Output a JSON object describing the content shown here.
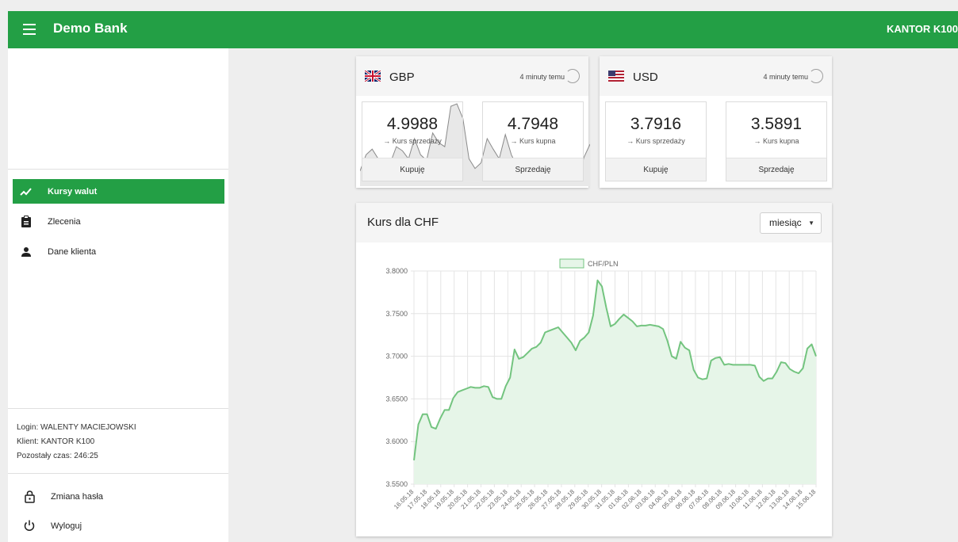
{
  "header": {
    "app_title": "Demo Bank",
    "account_label": "KANTOR K100"
  },
  "sidebar": {
    "nav": [
      {
        "label": "Kursy walut",
        "icon": "trending-up-icon",
        "active": true
      },
      {
        "label": "Zlecenia",
        "icon": "clipboard-icon",
        "active": false
      },
      {
        "label": "Dane klienta",
        "icon": "person-icon",
        "active": false
      }
    ],
    "session": {
      "login": "Login: WALENTY MACIEJOWSKI",
      "client": "Klient: KANTOR K100",
      "remaining": "Pozostały czas: 246:25"
    },
    "bottom": [
      {
        "label": "Zmiana hasła",
        "icon": "lock-icon"
      },
      {
        "label": "Wyloguj",
        "icon": "power-icon"
      }
    ]
  },
  "rates": [
    {
      "code": "GBP",
      "flag": "uk-flag-icon",
      "updated": "4 minuty temu",
      "sell": {
        "value": "4.9988",
        "label": "→ Kurs sprzedaży",
        "button": "Kupuję"
      },
      "buy": {
        "value": "4.7948",
        "label": "→ Kurs kupna",
        "button": "Sprzedaję"
      }
    },
    {
      "code": "USD",
      "flag": "us-flag-icon",
      "updated": "4 minuty temu",
      "sell": {
        "value": "3.7916",
        "label": "→ Kurs sprzedaży",
        "button": "Kupuję"
      },
      "buy": {
        "value": "3.5891",
        "label": "→ Kurs kupna",
        "button": "Sprzedaję"
      }
    }
  ],
  "chart_panel": {
    "title": "Kurs dla CHF",
    "period": "miesiąc"
  },
  "chart_data": {
    "type": "area",
    "legend": "CHF/PLN",
    "legend_position": "top",
    "color": "#73c47f",
    "fill": "#e6f5e8",
    "ylim": [
      3.55,
      3.8
    ],
    "yticks": [
      "3.8000",
      "3.7500",
      "3.7000",
      "3.6500",
      "3.6000",
      "3.5500"
    ],
    "categories": [
      "16.05.18",
      "17.05.18",
      "18.05.18",
      "19.05.18",
      "20.05.18",
      "21.05.18",
      "22.05.18",
      "23.05.18",
      "24.05.18",
      "25.05.18",
      "26.05.18",
      "27.05.18",
      "28.05.18",
      "29.05.18",
      "30.05.18",
      "31.05.18",
      "01.06.18",
      "02.06.18",
      "03.06.18",
      "04.06.18",
      "05.06.18",
      "06.06.18",
      "07.06.18",
      "08.06.18",
      "09.06.18",
      "10.06.18",
      "11.06.18",
      "12.06.18",
      "13.06.18",
      "14.06.18",
      "15.06.18"
    ],
    "values": [
      3.578,
      3.62,
      3.632,
      3.632,
      3.617,
      3.615,
      3.627,
      3.637,
      3.637,
      3.651,
      3.658,
      3.66,
      3.662,
      3.664,
      3.663,
      3.663,
      3.665,
      3.664,
      3.652,
      3.65,
      3.65,
      3.665,
      3.675,
      3.708,
      3.697,
      3.699,
      3.704,
      3.709,
      3.711,
      3.716,
      3.728,
      3.73,
      3.732,
      3.734,
      3.728,
      3.722,
      3.716,
      3.707,
      3.718,
      3.722,
      3.728,
      3.748,
      3.789,
      3.782,
      3.757,
      3.735,
      3.738,
      3.744,
      3.749,
      3.745,
      3.741,
      3.735,
      3.736,
      3.736,
      3.737,
      3.736,
      3.735,
      3.732,
      3.718,
      3.7,
      3.697,
      3.717,
      3.71,
      3.707,
      3.684,
      3.675,
      3.673,
      3.674,
      3.695,
      3.698,
      3.699,
      3.69,
      3.691,
      3.69,
      3.69,
      3.69,
      3.69,
      3.69,
      3.689,
      3.676,
      3.671,
      3.674,
      3.674,
      3.682,
      3.693,
      3.692,
      3.685,
      3.682,
      3.68,
      3.686,
      3.709,
      3.714,
      3.7
    ]
  },
  "sparklines": {
    "gbp": [
      0.15,
      0.35,
      0.42,
      0.3,
      0.12,
      0.25,
      0.45,
      0.4,
      0.3,
      0.55,
      0.35,
      0.28,
      0.62,
      0.5,
      0.45,
      0.95,
      0.98,
      0.8,
      0.3,
      0.18,
      0.25,
      0.55,
      0.42,
      0.3,
      0.6,
      0.35,
      0.2,
      0.1,
      0.05,
      0.1,
      0.25,
      0.12,
      0.08,
      0.04,
      0.18,
      0.1,
      0.05,
      0.32,
      0.48
    ]
  }
}
